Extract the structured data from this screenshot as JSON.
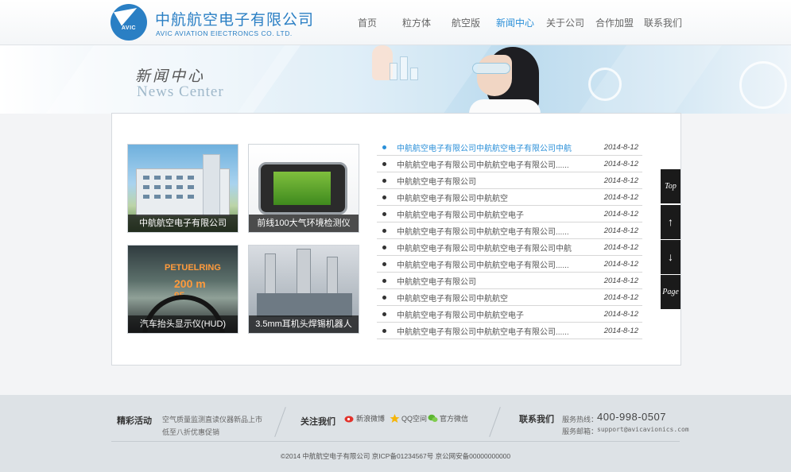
{
  "header": {
    "logo_badge": "AVIC",
    "logo_cn": "中航航空电子有限公司",
    "logo_en": "AVIC AVIATION EIECTRONCS CO. LTD.",
    "nav": [
      {
        "label": "首页",
        "active": false
      },
      {
        "label": "粒方体",
        "active": false
      },
      {
        "label": "航空版",
        "active": false
      },
      {
        "label": "新闻中心",
        "active": true
      },
      {
        "label": "关于公司",
        "active": false
      },
      {
        "label": "合作加盟",
        "active": false
      },
      {
        "label": "联系我们",
        "active": false
      }
    ],
    "active_color": "#2a8fd8"
  },
  "banner": {
    "title_cn": "新闻中心",
    "title_en": "News Center"
  },
  "thumbnails": [
    {
      "caption": "中航航空电子有限公司"
    },
    {
      "caption": "前线100大气环境检测仪"
    },
    {
      "caption": "汽车抬头显示仪(HUD)"
    },
    {
      "caption": "3.5mm耳机头焊锡机器人"
    }
  ],
  "hud_image_text": {
    "line1": "PETUELRING",
    "line2": "200 m",
    "line3": "95"
  },
  "news": [
    {
      "title": "中航航空电子有限公司中航航空电子有限公司中航",
      "date": "2014-8-12",
      "active": true
    },
    {
      "title": "中航航空电子有限公司中航航空电子有限公司......",
      "date": "2014-8-12",
      "active": false
    },
    {
      "title": "中航航空电子有限公司",
      "date": "2014-8-12",
      "active": false
    },
    {
      "title": "中航航空电子有限公司中航航空",
      "date": "2014-8-12",
      "active": false
    },
    {
      "title": "中航航空电子有限公司中航航空电子",
      "date": "2014-8-12",
      "active": false
    },
    {
      "title": "中航航空电子有限公司中航航空电子有限公司......",
      "date": "2014-8-12",
      "active": false
    },
    {
      "title": "中航航空电子有限公司中航航空电子有限公司中航",
      "date": "2014-8-12",
      "active": false
    },
    {
      "title": "中航航空电子有限公司中航航空电子有限公司......",
      "date": "2014-8-12",
      "active": false
    },
    {
      "title": "中航航空电子有限公司",
      "date": "2014-8-12",
      "active": false
    },
    {
      "title": "中航航空电子有限公司中航航空",
      "date": "2014-8-12",
      "active": false
    },
    {
      "title": "中航航空电子有限公司中航航空电子",
      "date": "2014-8-12",
      "active": false
    },
    {
      "title": "中航航空电子有限公司中航航空电子有限公司......",
      "date": "2014-8-12",
      "active": false
    }
  ],
  "side_buttons": {
    "top": "Top",
    "up_icon": "arrow-up-icon",
    "down_icon": "arrow-down-icon",
    "page": "Page"
  },
  "footer": {
    "events_title": "精彩活动",
    "events_line1": "空气质量监测直读仪器新品上市",
    "events_line2": "低至八折优惠促销",
    "follow_title": "关注我们",
    "social": [
      {
        "label": "新浪微博",
        "icon": "weibo-icon"
      },
      {
        "label": "QQ空间",
        "icon": "qzone-star-icon"
      },
      {
        "label": "官方微信",
        "icon": "wechat-icon"
      }
    ],
    "contact_title": "联系我们",
    "hotline_label": "服务热线：",
    "hotline": "400-998-0507",
    "email_label": "服务邮箱：",
    "email": "support@avicavionics.com",
    "copyright": "©2014 中航航空电子有限公司 京ICP备01234567号 京公网安备00000000000"
  }
}
